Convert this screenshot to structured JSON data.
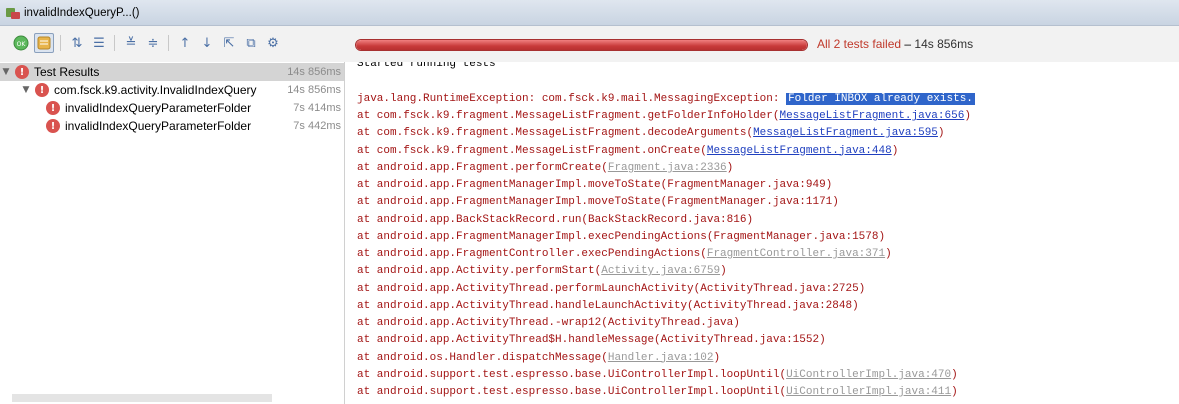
{
  "tab": {
    "title": "invalidIndexQueryP...()"
  },
  "toolbar": {
    "icons": [
      "run-icon",
      "stop-icon",
      "sort-alpha-icon",
      "sort-duration-icon",
      "expand-all-icon",
      "collapse-all-icon",
      "previous-icon",
      "next-icon",
      "export-icon",
      "import-icon",
      "settings-icon"
    ]
  },
  "progress": {
    "fraction": 1.0,
    "color": "#c83a3a"
  },
  "status": {
    "fail_text": "All 2 tests failed",
    "separator": " – ",
    "duration": "14s 856ms"
  },
  "tree": {
    "root": {
      "label": "Test Results",
      "time": "14s 856ms"
    },
    "suite": {
      "label": "com.fsck.k9.activity.InvalidIndexQuery",
      "time": "14s 856ms"
    },
    "tests": [
      {
        "label": "invalidIndexQueryParameterFolder",
        "time": "7s 414ms"
      },
      {
        "label": "invalidIndexQueryParameterFolder",
        "time": "7s 442ms"
      }
    ]
  },
  "console": {
    "header": "Started running tests",
    "exception_prefix": "java.lang.RuntimeException: com.fsck.k9.mail.MessagingException: ",
    "exception_highlight": "Folder INBOX already exists.",
    "frames": [
      {
        "pre": "at com.fsck.k9.fragment.MessageListFragment.getFolderInfoHolder(",
        "link": "MessageListFragment.java:656",
        "post": ")",
        "kind": "link"
      },
      {
        "pre": "at com.fsck.k9.fragment.MessageListFragment.decodeArguments(",
        "link": "MessageListFragment.java:595",
        "post": ")",
        "kind": "link"
      },
      {
        "pre": "at com.fsck.k9.fragment.MessageListFragment.onCreate(",
        "link": "MessageListFragment.java:448",
        "post": ")",
        "kind": "link"
      },
      {
        "pre": "at android.app.Fragment.performCreate(",
        "link": "Fragment.java:2336",
        "post": ")",
        "kind": "grey"
      },
      {
        "pre": "at android.app.FragmentManagerImpl.moveToState(FragmentManager.java:949)",
        "link": "",
        "post": "",
        "kind": "none"
      },
      {
        "pre": "at android.app.FragmentManagerImpl.moveToState(FragmentManager.java:1171)",
        "link": "",
        "post": "",
        "kind": "none"
      },
      {
        "pre": "at android.app.BackStackRecord.run(BackStackRecord.java:816)",
        "link": "",
        "post": "",
        "kind": "none"
      },
      {
        "pre": "at android.app.FragmentManagerImpl.execPendingActions(FragmentManager.java:1578)",
        "link": "",
        "post": "",
        "kind": "none"
      },
      {
        "pre": "at android.app.FragmentController.execPendingActions(",
        "link": "FragmentController.java:371",
        "post": ")",
        "kind": "grey"
      },
      {
        "pre": "at android.app.Activity.performStart(",
        "link": "Activity.java:6759",
        "post": ")",
        "kind": "grey"
      },
      {
        "pre": "at android.app.ActivityThread.performLaunchActivity(ActivityThread.java:2725)",
        "link": "",
        "post": "",
        "kind": "none"
      },
      {
        "pre": "at android.app.ActivityThread.handleLaunchActivity(ActivityThread.java:2848)",
        "link": "",
        "post": "",
        "kind": "none"
      },
      {
        "pre": "at android.app.ActivityThread.-wrap12(ActivityThread.java)",
        "link": "",
        "post": "",
        "kind": "none"
      },
      {
        "pre": "at android.app.ActivityThread$H.handleMessage(ActivityThread.java:1552)",
        "link": "",
        "post": "",
        "kind": "none"
      },
      {
        "pre": "at android.os.Handler.dispatchMessage(",
        "link": "Handler.java:102",
        "post": ")",
        "kind": "grey"
      },
      {
        "pre": "at android.support.test.espresso.base.UiControllerImpl.loopUntil(",
        "link": "UiControllerImpl.java:470",
        "post": ")",
        "kind": "grey"
      },
      {
        "pre": "at android.support.test.espresso.base.UiControllerImpl.loopUntil(",
        "link": "UiControllerImpl.java:411",
        "post": ")",
        "kind": "grey"
      }
    ]
  }
}
